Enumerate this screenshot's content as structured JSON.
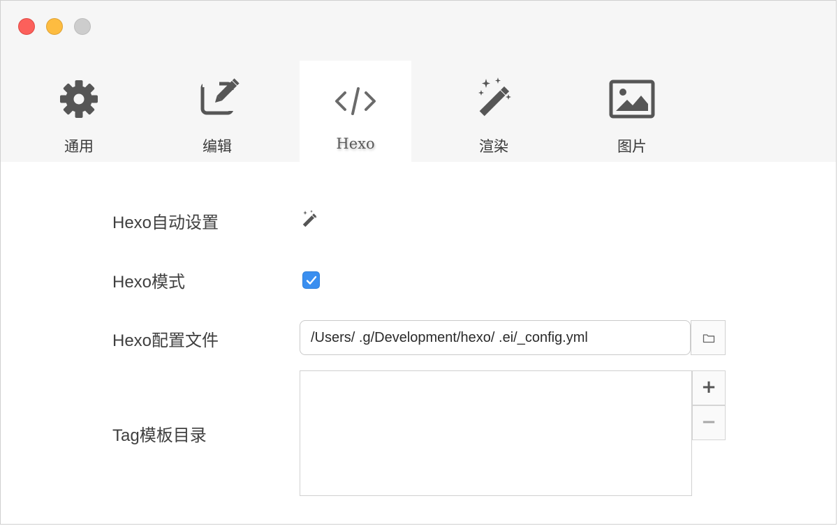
{
  "window": {
    "traffic_lights": [
      "close",
      "minimize",
      "zoom"
    ]
  },
  "toolbar": {
    "tabs": [
      {
        "label": "通用",
        "icon": "gear-icon"
      },
      {
        "label": "编辑",
        "icon": "edit-icon"
      },
      {
        "label": "Hexo",
        "icon": "code-icon",
        "active": true
      },
      {
        "label": "渲染",
        "icon": "magic-wand-icon"
      },
      {
        "label": "图片",
        "icon": "image-icon"
      }
    ]
  },
  "settings": {
    "auto_setup_label": "Hexo自动设置",
    "hexo_mode_label": "Hexo模式",
    "hexo_mode_checked": true,
    "config_file_label": "Hexo配置文件",
    "config_file_value": "/Users/     .g/Development/hexo/     .ei/_config.yml",
    "tag_template_label": "Tag模板目录",
    "tag_template_items": [],
    "add_symbol": "+",
    "remove_symbol": "−"
  },
  "colors": {
    "accent": "#3a8ff0",
    "close": "#fc605b",
    "minimize": "#fdbc40",
    "zoom": "#cdcdcd"
  }
}
